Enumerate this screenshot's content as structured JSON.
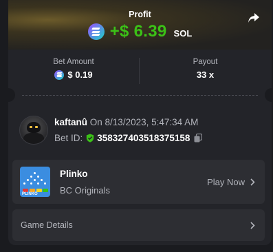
{
  "profit": {
    "label": "Profit",
    "amount": "+$ 6.39",
    "currency": "SOL"
  },
  "bet": {
    "amount_label": "Bet Amount",
    "amount_value": "$ 0.19",
    "payout_label": "Payout",
    "payout_value": "33 x"
  },
  "user": {
    "name": "kaftanû",
    "timestamp": "On 8/13/2023, 5:47:34 AM",
    "bet_id_label": "Bet ID:",
    "bet_id": "358327403518375158"
  },
  "game": {
    "name": "Plinko",
    "provider": "BC Originals",
    "action": "Play Now",
    "thumb_text": "PLINKO"
  },
  "details": {
    "label": "Game Details"
  },
  "icons": {
    "share": "share-icon",
    "currency": "solana-icon",
    "verified": "shield-check-icon",
    "copy": "copy-icon",
    "chevron": "chevron-right-icon"
  },
  "colors": {
    "accent_green": "#3bc117",
    "card_bg": "#232429",
    "row_bg": "#2d2e33",
    "muted_text": "#b3b5bc"
  }
}
